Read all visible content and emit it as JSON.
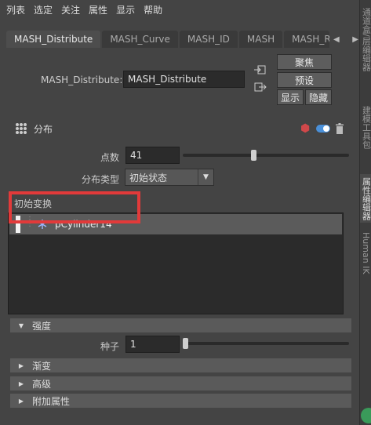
{
  "menu": [
    "列表",
    "选定",
    "关注",
    "属性",
    "显示",
    "帮助"
  ],
  "tabs": [
    {
      "label": "MASH_Distribute",
      "active": true
    },
    {
      "label": "MASH_Curve",
      "active": false
    },
    {
      "label": "MASH_ID",
      "active": false
    },
    {
      "label": "MASH",
      "active": false
    },
    {
      "label": "MASH_R",
      "active": false
    }
  ],
  "side_tabs": [
    "通道盒/层编辑器",
    "建模工具包",
    "属性编辑器",
    "Human IK"
  ],
  "node": {
    "label": "MASH_Distribute:",
    "value": "MASH_Distribute",
    "buttons": {
      "focus": "聚焦",
      "presets": "预设",
      "show": "显示",
      "hide": "隐藏"
    }
  },
  "section": {
    "title": "分布"
  },
  "fields": {
    "points_label": "点数",
    "points_value": "41",
    "points_slider": 0.41,
    "dist_type_label": "分布类型",
    "dist_type_value": "初始状态"
  },
  "initial_transform": {
    "label": "初始变换",
    "items": [
      "pCylinder14"
    ]
  },
  "strength": {
    "label": "强度",
    "seed_label": "种子",
    "seed_value": "1",
    "seed_slider": 0.0
  },
  "collapsed": [
    "渐变",
    "高级",
    "附加属性"
  ],
  "colors": {
    "highlight": "#e23a3a",
    "toggle": "#4a90d9"
  }
}
